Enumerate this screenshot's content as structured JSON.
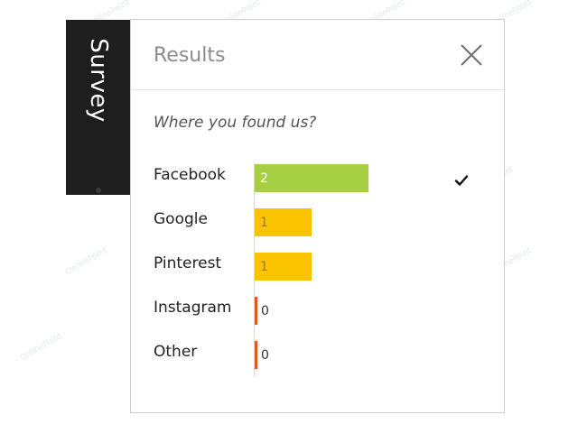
{
  "survey_tab": {
    "label": "Survey"
  },
  "panel": {
    "title": "Results",
    "question": "Where you found us?",
    "close_icon": "close-icon",
    "selected_icon": "checkmark-icon"
  },
  "chart_data": {
    "type": "bar",
    "orientation": "horizontal",
    "categories": [
      "Facebook",
      "Google",
      "Pinterest",
      "Instagram",
      "Other"
    ],
    "values": [
      2,
      1,
      1,
      0,
      0
    ],
    "bar_colors": [
      "#a7cf43",
      "#f9c300",
      "#f9c300",
      "#e4571f",
      "#e4571f"
    ],
    "selected": "Facebook"
  },
  "watermark": {
    "text": "OnlinePoint"
  }
}
